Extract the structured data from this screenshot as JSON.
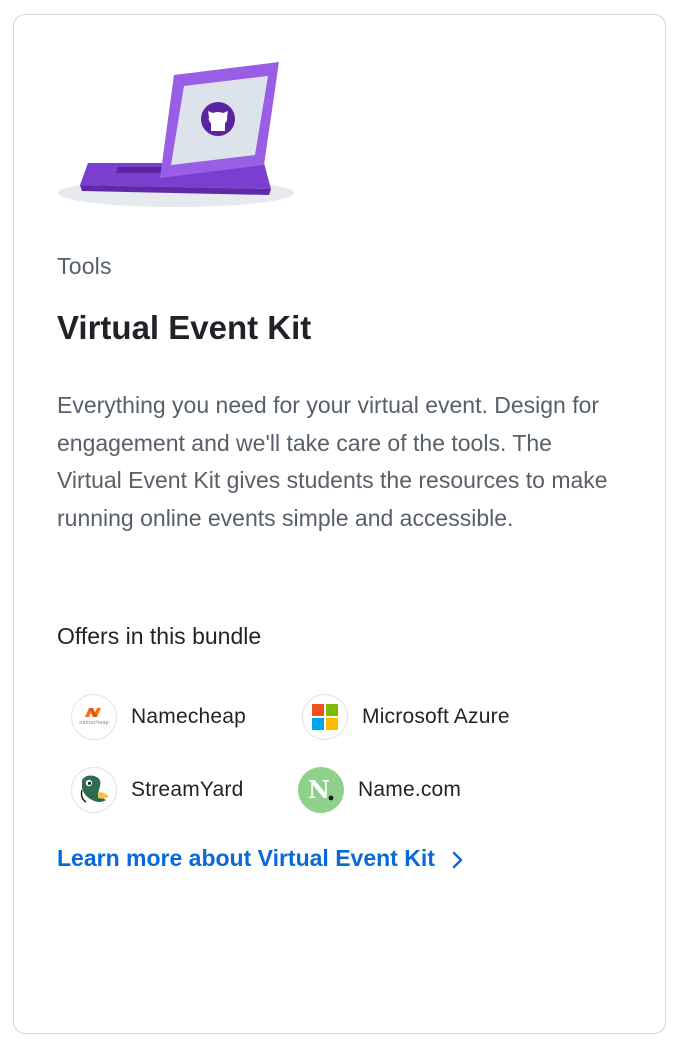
{
  "card": {
    "category": "Tools",
    "title": "Virtual Event Kit",
    "description": "Everything you need for your virtual event. Design for engagement and we'll take care of the tools. The Virtual Event Kit gives students the resources to make running online events simple and accessible.",
    "offers_heading": "Offers in this bundle",
    "offers": [
      {
        "name": "Namecheap",
        "icon": "namecheap-logo",
        "logo_caption": "namecheap"
      },
      {
        "name": "Microsoft Azure",
        "icon": "microsoft-logo"
      },
      {
        "name": "StreamYard",
        "icon": "streamyard-logo"
      },
      {
        "name": "Name.com",
        "icon": "namecom-logo"
      }
    ],
    "learn_more": "Learn more about Virtual Event Kit",
    "illustration": "laptop-github-illustration"
  },
  "colors": {
    "link": "#0969da",
    "laptop_purple": "#8a4fd8",
    "muted_text": "#57606a",
    "heading_text": "#1f2328"
  }
}
